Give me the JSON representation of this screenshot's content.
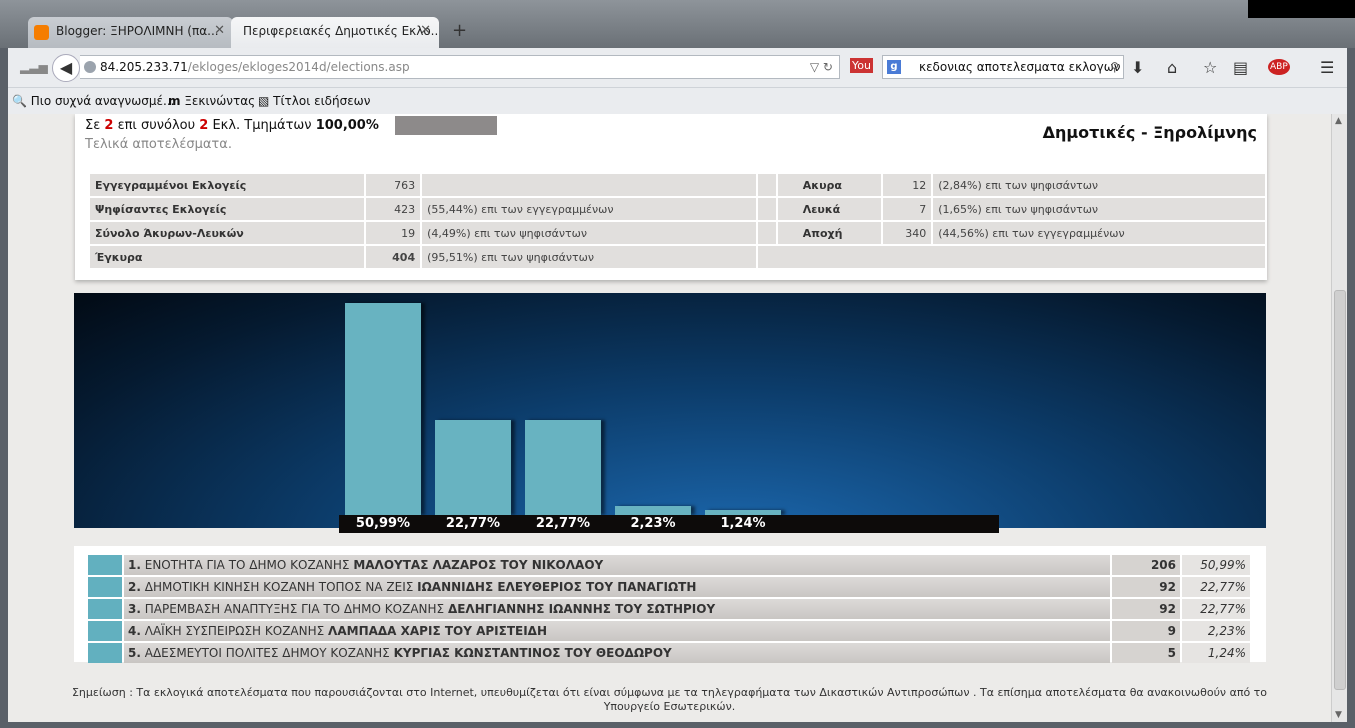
{
  "browser": {
    "tabs": [
      {
        "title": "Blogger: ΞΗΡΟΛΙΜΝΗ (πα..."
      },
      {
        "title": "Περιφερειακές Δημοτικές Εκλο..."
      }
    ],
    "url_host": "84.205.233.71",
    "url_path": "/ekloges/ekloges2014d/elections.asp",
    "search_text": "κεδονιας αποτελεσματα εκλογων",
    "bookmarks": [
      "Πιο συχνά αναγνωσμέ...",
      "Ξεκινώντας",
      "Τίτλοι ειδήσεων"
    ]
  },
  "header": {
    "pre": "Σε",
    "counted": "2",
    "mid": "επι συνόλου",
    "total": "2",
    "post": "Εκλ. Τμημάτων",
    "percent": "100,00%",
    "final": "Τελικά αποτελέσματα.",
    "title": "Δημοτικές - Ξηρολίμνης"
  },
  "stats": {
    "left": [
      {
        "label": "Εγγεγραμμένοι Εκλογείς",
        "value": "763",
        "pct": ""
      },
      {
        "label": "Ψηφίσαντες Εκλογείς",
        "value": "423",
        "pct": "(55,44%) επι των εγγεγραμμένων"
      },
      {
        "label": "Σύνολο Άκυρων-Λευκών",
        "value": "19",
        "pct": "(4,49%) επι των ψηφισάντων"
      },
      {
        "label": "Έγκυρα",
        "value": "404",
        "pct": "(95,51%) επι των ψηφισάντων"
      }
    ],
    "right": [
      {
        "label": "Ακυρα",
        "value": "12",
        "pct": "(2,84%) επι των ψηφισάντων"
      },
      {
        "label": "Λευκά",
        "value": "7",
        "pct": "(1,65%) επι των ψηφισάντων"
      },
      {
        "label": "Αποχή",
        "value": "340",
        "pct": "(44,56%) επι των εγγεγραμμένων"
      }
    ]
  },
  "chart_data": {
    "type": "bar",
    "categories": [
      "1",
      "2",
      "3",
      "4",
      "5"
    ],
    "values": [
      50.99,
      22.77,
      22.77,
      2.23,
      1.24
    ],
    "labels": [
      "50,99%",
      "22,77%",
      "22,77%",
      "2,23%",
      "1,24%"
    ],
    "bar_color": "#68b3c1"
  },
  "results": [
    {
      "num": "1.",
      "party": "ΕΝΟΤΗΤΑ ΓΙΑ ΤΟ ΔΗΜΟ ΚΟΖΑΝΗΣ",
      "candidate": "ΜΑΛΟΥΤΑΣ ΛΑΖΑΡΟΣ ΤΟΥ ΝΙΚΟΛΑΟΥ",
      "votes": "206",
      "pct": "50,99%"
    },
    {
      "num": "2.",
      "party": "ΔΗΜΟΤΙΚΗ ΚΙΝΗΣΗ ΚΟΖΑΝΗ ΤΟΠΟΣ ΝΑ ΖΕΙΣ",
      "candidate": "ΙΩΑΝΝΙΔΗΣ ΕΛΕΥΘΕΡΙΟΣ ΤΟΥ ΠΑΝΑΓΙΩΤΗ",
      "votes": "92",
      "pct": "22,77%"
    },
    {
      "num": "3.",
      "party": "ΠΑΡΕΜΒΑΣΗ ΑΝΑΠΤΥΞΗΣ ΓΙΑ ΤΟ ΔΗΜΟ ΚΟΖΑΝΗΣ",
      "candidate": "ΔΕΛΗΓΙΑΝΝΗΣ ΙΩΑΝΝΗΣ ΤΟΥ ΣΩΤΗΡΙΟΥ",
      "votes": "92",
      "pct": "22,77%"
    },
    {
      "num": "4.",
      "party": "ΛΑΪΚΗ ΣΥΣΠΕΙΡΩΣΗ ΚΟΖΑΝΗΣ",
      "candidate": "ΛΑΜΠΑΔΑ ΧΑΡΙΣ ΤΟΥ ΑΡΙΣΤΕΙΔΗ",
      "votes": "9",
      "pct": "2,23%"
    },
    {
      "num": "5.",
      "party": "ΑΔΕΣΜΕΥΤΟΙ ΠΟΛΙΤΕΣ ΔΗΜΟΥ ΚΟΖΑΝΗΣ",
      "candidate": "ΚΥΡΓΙΑΣ ΚΩΝΣΤΑΝΤΙΝΟΣ ΤΟΥ ΘΕΟΔΩΡΟΥ",
      "votes": "5",
      "pct": "1,24%"
    }
  ],
  "note_line1": "Σημείωση : Τα εκλογικά αποτελέσματα που παρουσιάζονται στο Internet, υπευθυμίζεται ότι είναι σύμφωνα με τα τηλεγραφήματα των Δικαστικών Αντιπροσώπων . Τα επίσημα αποτελέσματα θα ανακοινωθούν από το",
  "note_line2": "Υπουργείο Εσωτερικών."
}
